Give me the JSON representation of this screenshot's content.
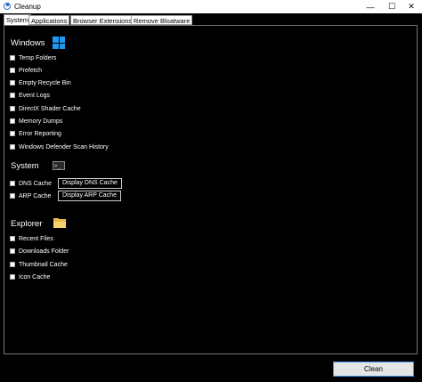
{
  "window": {
    "title": "Cleanup",
    "minimize": "—",
    "maximize": "☐",
    "close": "✕"
  },
  "tabs": [
    {
      "label": "System",
      "active": true
    },
    {
      "label": "Applications",
      "active": false
    },
    {
      "label": "Browser Extensions",
      "active": false
    },
    {
      "label": "Remove Bloatware",
      "active": false
    }
  ],
  "sections": {
    "windows": {
      "title": "Windows",
      "icon": "windows-logo-icon",
      "items": [
        "Temp Folders",
        "Prefetch",
        "Empty Recycle Bin",
        "Event Logs",
        "DirectX Shader Cache",
        "Memory Dumps",
        "Error Reporting",
        "Windows Defender Scan History"
      ]
    },
    "system": {
      "title": "System",
      "icon": "terminal-icon",
      "terminal_glyph": ">_",
      "items": [
        "DNS Cache",
        "ARP Cache"
      ],
      "buttons": [
        "Display DNS Cache",
        "Display ARP Cache"
      ]
    },
    "explorer": {
      "title": "Explorer",
      "icon": "folder-icon",
      "items": [
        "Recent Files",
        "Downloads Folder",
        "Thumbnail Cache",
        "Icon Cache"
      ]
    }
  },
  "footer": {
    "clean_label": "Clean"
  },
  "colors": {
    "accent": "#1e9bf0",
    "button_border": "#3c8be8",
    "background": "#000000"
  }
}
